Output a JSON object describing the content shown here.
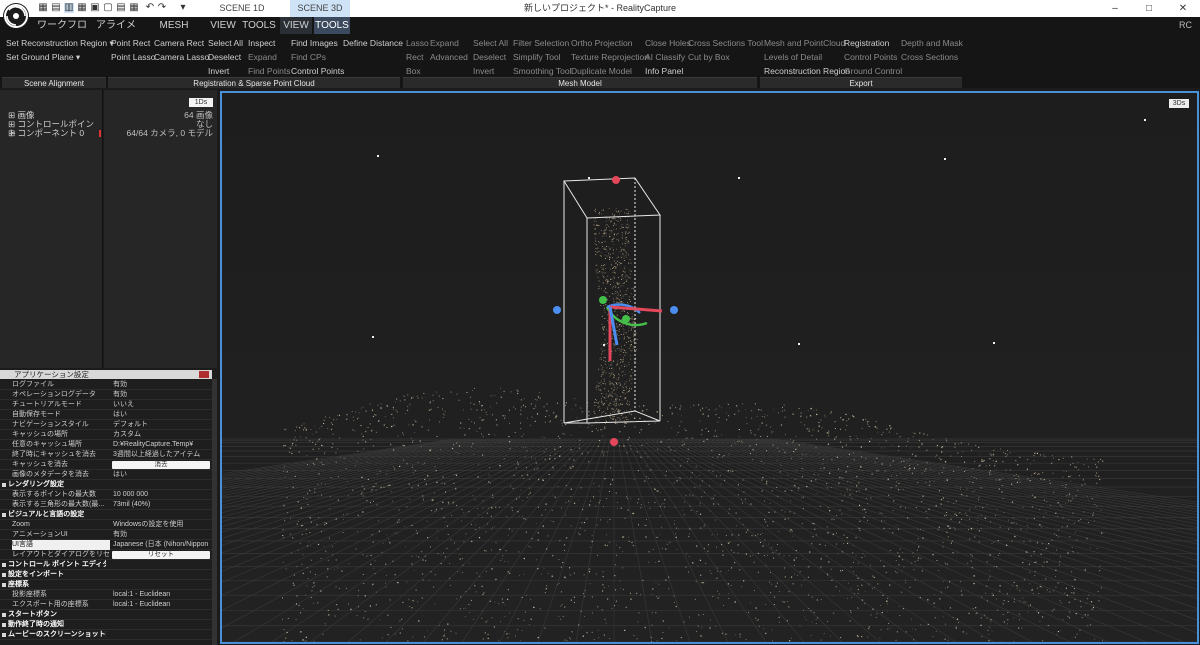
{
  "titlebar": {
    "scene_1d": "SCENE 1D",
    "scene_3d": "SCENE 3D",
    "title": "新しいプロジェクト* - RealityCapture",
    "minimize": "–",
    "maximize": "□",
    "close": "✕"
  },
  "menu": {
    "workflow": "ワークフロー",
    "alignment": "アライメント",
    "mesh_model": "MESH MODEL",
    "view1": "VIEW",
    "tools1": "TOOLS",
    "view2": "VIEW",
    "tools2": "TOOLS",
    "rc": "RC"
  },
  "ribbon": {
    "scene_alignment": {
      "label": "Scene Alignment",
      "set_reconstruction_region": "Set Reconstruction Region ▾",
      "set_ground_plane": "Set Ground Plane ▾"
    },
    "registration": {
      "label": "Registration & Sparse Point Cloud",
      "point_rect": "Point Rect",
      "camera_rect": "Camera Rect",
      "select_all": "Select All",
      "inspect": "Inspect",
      "find_images": "Find Images",
      "define_distance": "Define Distance",
      "point_lasso": "Point Lasso",
      "camera_lasso": "Camera Lasso",
      "deselect": "Deselect",
      "expand": "Expand",
      "find_cps": "Find CPs",
      "invert": "Invert",
      "find_points": "Find Points",
      "control_points": "Control Points"
    },
    "mesh_model": {
      "label": "Mesh Model",
      "lasso": "Lasso",
      "expand": "Expand",
      "select_all": "Select All",
      "filter_selection": "Filter Selection",
      "ortho_projection": "Ortho Projection",
      "close_holes": "Close Holes",
      "cross_sections_tool": "Cross Sections Tool",
      "rect": "Rect",
      "advanced": "Advanced",
      "deselect": "Deselect",
      "simplify_tool": "Simplify Tool",
      "texture_reprojection": "Texture Reprojection",
      "ai_classify": "AI Classify",
      "cut_by_box": "Cut by Box",
      "box": "Box",
      "invert": "Invert",
      "smoothing_tool": "Smoothing Tool",
      "duplicate_model": "Duplicate Model",
      "info_panel": "Info Panel"
    },
    "export": {
      "label": "Export",
      "mesh_and_point_cloud": "Mesh and PointCloud",
      "registration": "Registration",
      "depth_and_mask": "Depth and Mask",
      "levels_of_detail": "Levels of Detail",
      "control_points": "Control Points",
      "cross_sections": "Cross Sections",
      "reconstruction_region": "Reconstruction Region",
      "ground_control": "Ground Control"
    }
  },
  "tree": {
    "badge": "1Ds",
    "items": [
      {
        "label": "画像",
        "value": "64 画像"
      },
      {
        "label": "コントロールポイント",
        "value": "なし"
      },
      {
        "label": "コンポーネント 0",
        "value": "64/64 カメラ, 0 モデル"
      }
    ]
  },
  "settings": {
    "title": "アプリケーション設定",
    "rows": [
      {
        "k": "ログファイル",
        "v": "有効"
      },
      {
        "k": "オペレーションログデータ",
        "v": "有効"
      },
      {
        "k": "チュートリアルモード",
        "v": "いいえ"
      },
      {
        "k": "自動保存モード",
        "v": "はい"
      },
      {
        "k": "ナビゲーションスタイル",
        "v": "デフォルト"
      },
      {
        "k": "キャッシュの場所",
        "v": "カスタム"
      },
      {
        "k": "任意のキャッシュ場所",
        "v": "D:¥RealityCapture.Temp¥"
      },
      {
        "k": "終了時にキャッシュを消去",
        "v": "3週間以上経過したアイテム"
      },
      {
        "k": "キャッシュを消去",
        "btn": "消去"
      },
      {
        "k": "画像のメタデータを消去",
        "v": "はい"
      },
      {
        "k": "レンダリング設定",
        "sec": true
      },
      {
        "k": "表示するポイントの最大数",
        "v": "10 000 000"
      },
      {
        "k": "表示する三角形の最大数(最...",
        "v": "73mil (40%)"
      },
      {
        "k": "ビジュアルと言語の設定",
        "sec": true
      },
      {
        "k": "Zoom",
        "v": "Windowsの設定を使用"
      },
      {
        "k": "アニメーションUI",
        "v": "有効"
      },
      {
        "k": "UI言語",
        "v": "Japanese (日本 (Nihon/Nippon",
        "hl": true
      },
      {
        "k": "レイアウトとダイアログをリセット",
        "btn": "リセット"
      },
      {
        "k": "コントロール ポイント エディターの明るさの向上",
        "sec": true
      },
      {
        "k": "設定をインポート",
        "sec": true
      },
      {
        "k": "座標系",
        "sec": true
      },
      {
        "k": "投影座標系",
        "v": "local:1 - Euclidean"
      },
      {
        "k": "エクスポート用の座標系",
        "v": "local:1 - Euclidean"
      },
      {
        "k": "スタートボタン",
        "sec": true
      },
      {
        "k": "動作終了時の通知",
        "sec": true
      },
      {
        "k": "ムービーのスクリーンショット撮影",
        "sec": true
      }
    ]
  },
  "viewport": {
    "badge": "3Ds"
  },
  "colors": {
    "accent_blue": "#4a90d9",
    "handle_red": "#e2475a",
    "handle_blue": "#4c8df0",
    "handle_green": "#44c04a",
    "points": "#e7d9b9"
  }
}
